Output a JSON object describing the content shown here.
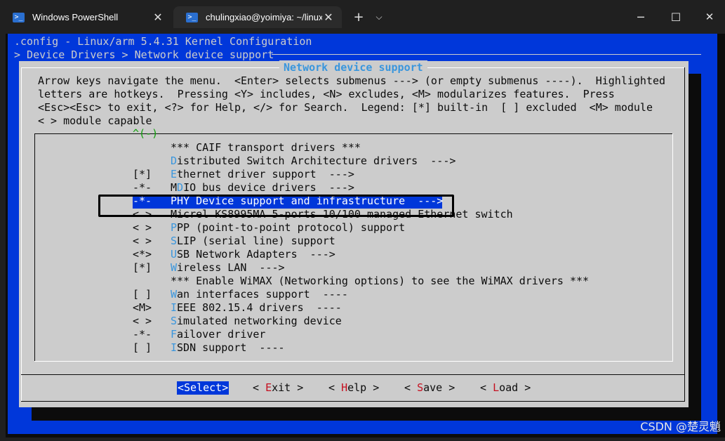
{
  "tabs": [
    {
      "label": "Windows PowerShell",
      "close": "✕",
      "icon": "powershell-icon"
    },
    {
      "label": "chulingxiao@yoimiya: ~/linux",
      "close": "✕",
      "icon": "powershell-icon"
    }
  ],
  "titlebar": {
    "new_tab": "+",
    "dropdown": "⌵",
    "minimize": "─",
    "maximize": "☐",
    "close": "✕"
  },
  "header": {
    "line1": ".config - Linux/arm 5.4.31 Kernel Configuration",
    "line2": "> Device Drivers > Network device support"
  },
  "dialog": {
    "title": "Network device support",
    "help": [
      "Arrow keys navigate the menu.  <Enter> selects submenus ---> (or empty submenus ----).  Highlighted",
      "letters are hotkeys.  Pressing <Y> includes, <N> excludes, <M> modularizes features.  Press",
      "<Esc><Esc> to exit, <?> for Help, </> for Search.  Legend: [*] built-in  [ ] excluded  <M> module",
      "< > module capable"
    ],
    "scroll_indicator": "^(-)",
    "menu": [
      {
        "mark": "",
        "pre": "",
        "hk": "",
        "rest": "*** CAIF transport drivers ***"
      },
      {
        "mark": "",
        "pre": "",
        "hk": "D",
        "rest": "istributed Switch Architecture drivers  --->"
      },
      {
        "mark": "[*]",
        "pre": "",
        "hk": "E",
        "rest": "thernet driver support  --->"
      },
      {
        "mark": "-*-",
        "pre": "M",
        "hk": "D",
        "rest": "IO bus device drivers  --->"
      },
      {
        "mark": "-*-",
        "pre": "",
        "hk": "P",
        "rest": "HY Device support and infrastructure  --->"
      },
      {
        "mark": "< >",
        "pre": "",
        "hk": "",
        "rest": "Micrel KS8995MA 5-ports 10/100 managed Ethernet switch"
      },
      {
        "mark": "< >",
        "pre": "",
        "hk": "P",
        "rest": "PP (point-to-point protocol) support"
      },
      {
        "mark": "< >",
        "pre": "",
        "hk": "S",
        "rest": "LIP (serial line) support"
      },
      {
        "mark": "<*>",
        "pre": "",
        "hk": "U",
        "rest": "SB Network Adapters  --->"
      },
      {
        "mark": "[*]",
        "pre": "",
        "hk": "W",
        "rest": "ireless LAN  --->"
      },
      {
        "mark": "",
        "pre": "",
        "hk": "",
        "rest": "*** Enable WiMAX (Networking options) to see the WiMAX drivers ***"
      },
      {
        "mark": "[ ]",
        "pre": "",
        "hk": "W",
        "rest": "an interfaces support  ----"
      },
      {
        "mark": "<M>",
        "pre": "",
        "hk": "I",
        "rest": "EEE 802.15.4 drivers  ----"
      },
      {
        "mark": "< >",
        "pre": "",
        "hk": "S",
        "rest": "imulated networking device"
      },
      {
        "mark": "-*-",
        "pre": "",
        "hk": "F",
        "rest": "ailover driver"
      },
      {
        "mark": "[ ]",
        "pre": "",
        "hk": "I",
        "rest": "SDN support  ----"
      }
    ],
    "selected_index": 4,
    "buttons": {
      "select": "<Select>",
      "exit": {
        "open": "< ",
        "hk": "E",
        "rest": "xit",
        "close": " >"
      },
      "help": {
        "open": "< ",
        "hk": "H",
        "rest": "elp",
        "close": " >"
      },
      "save": {
        "open": "< ",
        "hk": "S",
        "rest": "ave",
        "close": " >"
      },
      "load": {
        "open": "< ",
        "hk": "L",
        "rest": "oad",
        "close": " >"
      }
    }
  },
  "watermark": "CSDN @楚灵魈",
  "colors": {
    "terminal_blue": "#0037da",
    "dialog_gray": "#cccccc",
    "hotkey": "#3a96dd",
    "button_hotkey": "#c50f1f",
    "annotation": "#000000"
  }
}
